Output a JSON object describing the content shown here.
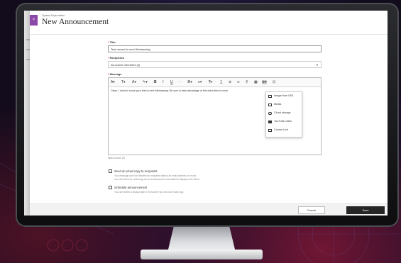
{
  "header": {
    "course_name": "Space Exploration",
    "page_title": "New Announcement"
  },
  "form": {
    "title_label": "Title",
    "title_value": "Test moved to next Wednesday",
    "recipients_label": "Recipients",
    "recipients_value": "All course members (3)",
    "message_label": "Message",
    "message_text": "Class, I need to move your test to next Wednesday. Be sure to take advantage of this extra time to revie",
    "word_count": "Word count: 25"
  },
  "toolbar": {
    "paragraph": "A▾",
    "format": "T▾",
    "font_size": "A▾",
    "color": "✎▾",
    "bold": "B",
    "italic": "I",
    "underline": "U",
    "strike": "⋯",
    "list": "≣▾",
    "align": "≡▾",
    "indent": "¶▾",
    "math": "∑",
    "link": "⊘",
    "unlink": "∞",
    "attach": "⚲",
    "table": "▦",
    "insert_content": "⊕▾",
    "fullscreen": "⊡"
  },
  "insert_menu": {
    "items": [
      {
        "label": "Image from URL",
        "icon": "image-icon"
      },
      {
        "label": "Media",
        "icon": "media-icon"
      },
      {
        "label": "Cloud storage",
        "icon": "cloud-icon"
      },
      {
        "label": "YouTube video",
        "icon": "video-icon"
      },
      {
        "label": "Course Link",
        "icon": "link-icon"
      }
    ]
  },
  "options": {
    "email_label": "Send an email copy to recipients",
    "email_hint_1": "Your message won't be delivered to recipients without an email address on record.",
    "email_hint_2": "You can't send an email copy for an announcement scheduled to display in the future.",
    "schedule_label": "Schedule announcement",
    "schedule_hint": "You can't select a display date in the future if you send an email copy."
  },
  "actions": {
    "cancel": "Cancel",
    "save": "Save"
  },
  "colors": {
    "accent": "#8b48a8",
    "save_button": "#262626"
  }
}
